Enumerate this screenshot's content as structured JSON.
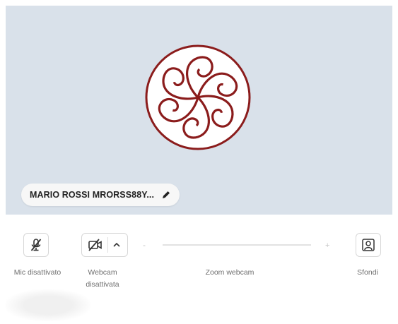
{
  "preview": {
    "participant_name": "MARIO ROSSI MRORSS88Y...",
    "background_color": "#d9e1ea",
    "logo_color": "#8b1c1c",
    "logo_icon": "rosette-logo-icon"
  },
  "controls": {
    "mic": {
      "label": "Mic disattivato",
      "icon": "mic-off-icon"
    },
    "webcam": {
      "label_line1": "Webcam",
      "label_line2": "disattivata",
      "icon": "video-off-icon"
    },
    "zoom": {
      "label": "Zoom webcam",
      "minus": "-",
      "plus": "+",
      "level": 0
    },
    "backgrounds": {
      "label": "Sfondi",
      "icon": "background-person-icon"
    }
  }
}
